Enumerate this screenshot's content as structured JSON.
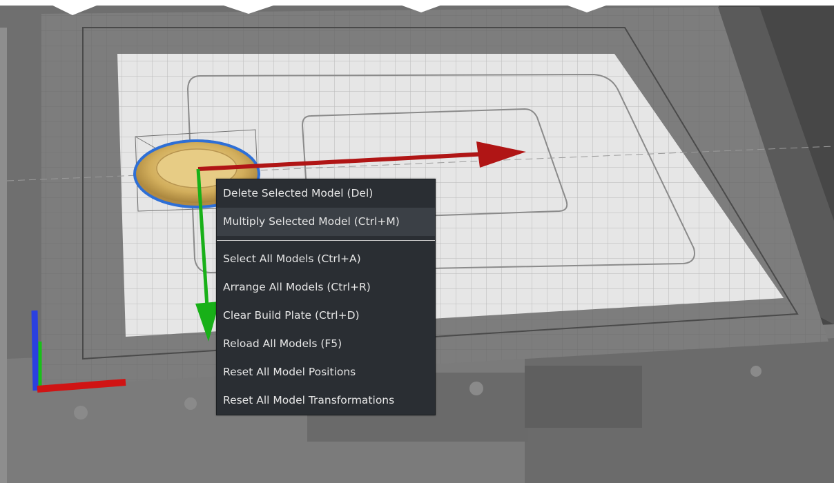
{
  "viewport": {
    "background_color": "#6e6e6e",
    "plate_color": "#e8e8e8",
    "x_axis_color": "#c01010",
    "y_axis_color": "#10b010",
    "z_axis_color": "#2a40e0",
    "model_color": "#d9b86a",
    "selection_color": "#2e6fd6"
  },
  "context_menu": {
    "items_top": [
      {
        "label": "Delete Selected Model (Del)",
        "name": "menu-item-delete-selected-model"
      },
      {
        "label": "Multiply Selected Model (Ctrl+M)",
        "name": "menu-item-multiply-selected-model",
        "hover": true
      }
    ],
    "items_bottom": [
      {
        "label": "Select All Models (Ctrl+A)",
        "name": "menu-item-select-all-models"
      },
      {
        "label": "Arrange All Models (Ctrl+R)",
        "name": "menu-item-arrange-all-models"
      },
      {
        "label": "Clear Build Plate (Ctrl+D)",
        "name": "menu-item-clear-build-plate"
      },
      {
        "label": "Reload All Models (F5)",
        "name": "menu-item-reload-all-models"
      },
      {
        "label": "Reset All Model Positions",
        "name": "menu-item-reset-all-model-positions"
      },
      {
        "label": "Reset All Model Transformations",
        "name": "menu-item-reset-all-model-transformations"
      }
    ]
  }
}
